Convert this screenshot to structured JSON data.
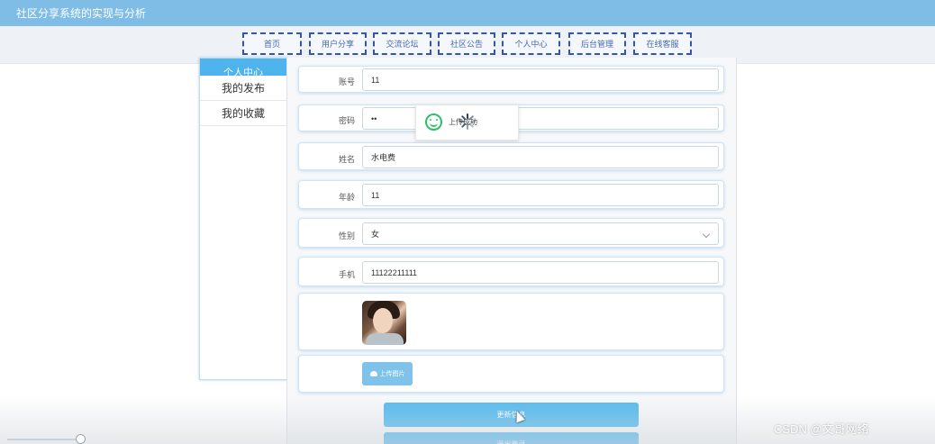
{
  "header": {
    "title": "社区分享系统的实现与分析"
  },
  "nav": {
    "items": [
      {
        "label": "首页"
      },
      {
        "label": "用户分享"
      },
      {
        "label": "交流论坛"
      },
      {
        "label": "社区公告"
      },
      {
        "label": "个人中心"
      },
      {
        "label": "后台管理"
      },
      {
        "label": "在线客服"
      }
    ]
  },
  "sidebar": {
    "heading": "个人中心",
    "items": [
      {
        "label": "我的发布"
      },
      {
        "label": "我的收藏"
      }
    ]
  },
  "form": {
    "account": {
      "label": "账号",
      "value": "11"
    },
    "password": {
      "label": "密码",
      "value": "••"
    },
    "name": {
      "label": "姓名",
      "value": "水电费"
    },
    "age": {
      "label": "年龄",
      "value": "11"
    },
    "gender": {
      "label": "性别",
      "value": "女"
    },
    "phone": {
      "label": "手机",
      "value": "11122211111"
    },
    "upload_label": "上传图片",
    "update_label": "更新信息",
    "logout_label": "退出登录"
  },
  "toast": {
    "message": "上传成功"
  },
  "watermark": "CSDN @文哥网络",
  "colors": {
    "topbar": "#7fbde6",
    "accent": "#55bbf0",
    "nav_border": "#3355aa",
    "success": "#2dbf68"
  }
}
